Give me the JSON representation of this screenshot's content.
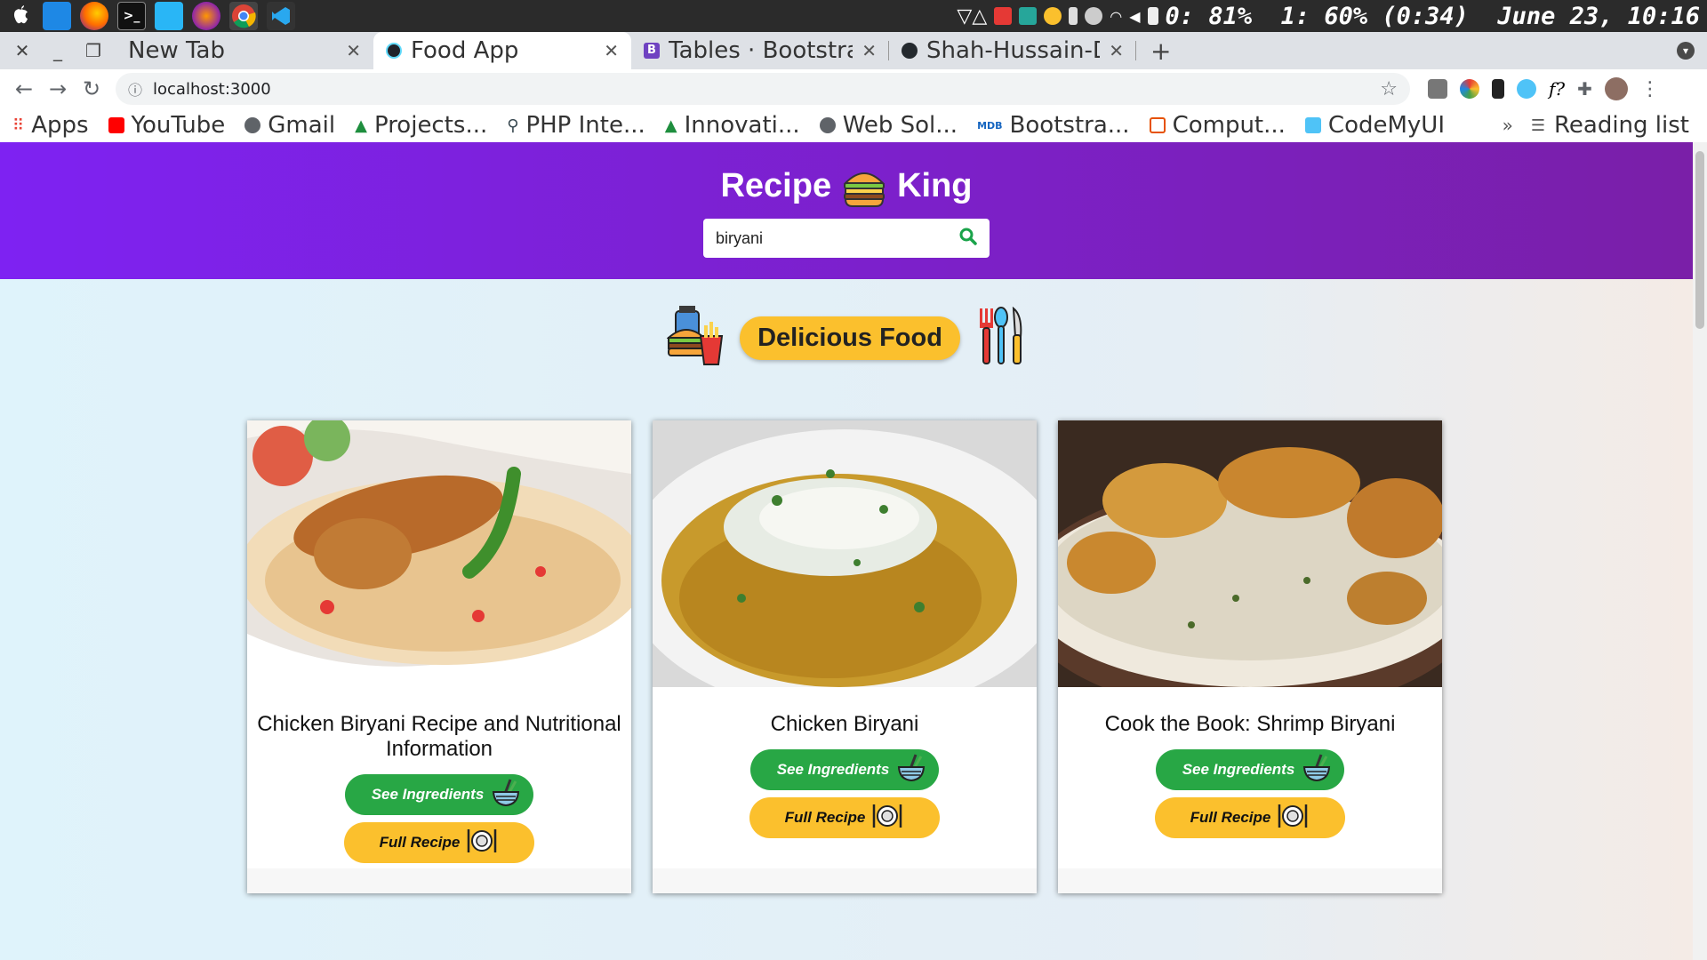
{
  "system": {
    "apps": [
      "apple-icon",
      "blue-window-icon",
      "firefox-icon",
      "terminal-icon",
      "files-icon",
      "cerebro-icon",
      "chrome-icon",
      "vscode-icon"
    ],
    "status_text": "0: 81%  1: 60% (0:34)  June 23, 10:16"
  },
  "browser": {
    "tabs": [
      {
        "title": "New Tab",
        "favicon": "none"
      },
      {
        "title": "Food App",
        "favicon": "react-icon"
      },
      {
        "title": "Tables · Bootstra",
        "favicon": "bootstrap-icon"
      },
      {
        "title": "Shah-Hussain-De",
        "favicon": "github-icon"
      }
    ],
    "new_tab_label": "+",
    "url": "localhost:3000",
    "bookmarks": [
      {
        "label": "Apps",
        "color": "#e94235"
      },
      {
        "label": "YouTube",
        "color": "#ff0000"
      },
      {
        "label": "Gmail",
        "color": "#5f6368"
      },
      {
        "label": "Projects...",
        "color": "#1e8e3e"
      },
      {
        "label": "PHP Inte...",
        "color": "#37474f"
      },
      {
        "label": "Innovati...",
        "color": "#1e8e3e"
      },
      {
        "label": "Web Sol...",
        "color": "#5f6368"
      },
      {
        "label": "Bootstra...",
        "color": "#1565c0"
      },
      {
        "label": "Comput...",
        "color": "#e65100"
      },
      {
        "label": "CodeMyUI",
        "color": "#4fc3f7"
      }
    ],
    "more_bookmarks": "»",
    "reading_list": "Reading list"
  },
  "app": {
    "brand_left": "Recipe",
    "brand_right": "King",
    "search": {
      "value": "biryani",
      "placeholder": ""
    },
    "banner_label": "Delicious Food",
    "cards": [
      {
        "title": "Chicken Biryani Recipe and Nutritional Information",
        "ingredients_label": "See Ingredients",
        "recipe_label": "Full Recipe"
      },
      {
        "title": "Chicken Biryani",
        "ingredients_label": "See Ingredients",
        "recipe_label": "Full Recipe"
      },
      {
        "title": "Cook the Book: Shrimp Biryani",
        "ingredients_label": "See Ingredients",
        "recipe_label": "Full Recipe"
      }
    ]
  },
  "colors": {
    "header_start": "#7e22f2",
    "header_end": "#7a1fa8",
    "ingredients_button": "#28a745",
    "recipe_button": "#fbc02d"
  }
}
